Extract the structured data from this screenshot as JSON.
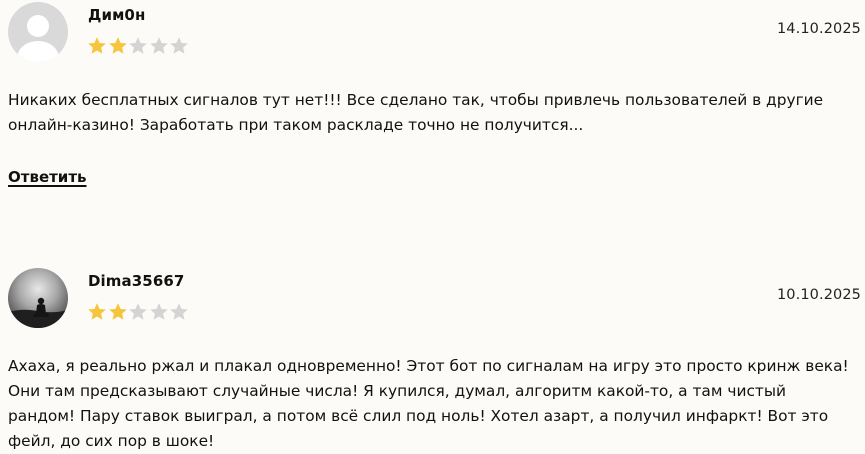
{
  "reviews": [
    {
      "author": "Дим0н",
      "avatar_icon": "default-user-avatar-icon",
      "rating": 2,
      "max_rating": 5,
      "date": "14.10.2025",
      "text": "Никаких бесплатных сигналов тут нет!!! Все сделано так, чтобы привлечь пользователей в другие онлайн-казино! Заработать при таком раскладе точно не получится...",
      "reply_label": "Ответить"
    },
    {
      "author": "Dima35667",
      "avatar_icon": "photo-avatar-icon",
      "rating": 2,
      "max_rating": 5,
      "date": "10.10.2025",
      "text": "Ахаха, я реально ржал и плакал одновременно! Этот бот по сигналам на игру это просто кринж века! Они там предсказывают случайные числа! Я купился, думал, алгоритм какой-то, а там чистый рандом! Пару ставок выиграл, а потом всё слил под ноль! Хотел азарт, а получил инфаркт! Вот это фейл, до сих пор в шоке!"
    }
  ],
  "colors": {
    "background": "#fdfbf7",
    "star_filled": "#f5c53d",
    "star_empty": "#d4d4d4",
    "avatar_placeholder_bg": "#d9d9d9"
  }
}
